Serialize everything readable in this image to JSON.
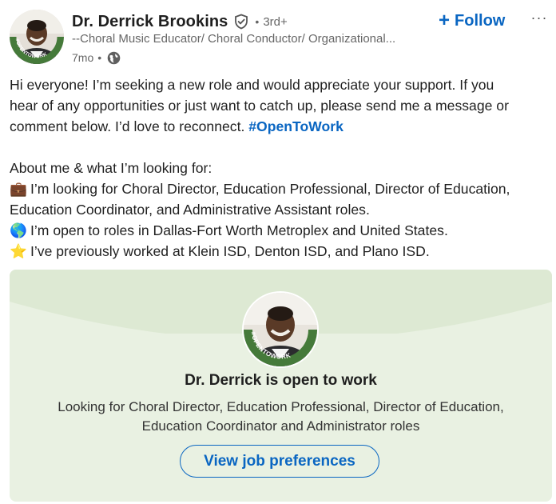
{
  "actor": {
    "name": "Dr. Derrick Brookins",
    "degree": "3rd+",
    "headline": "--Choral Music Educator/ Choral Conductor/ Organizational...",
    "time_ago": "7mo",
    "badge_text": "#OPENTOWORK"
  },
  "actions": {
    "follow_label": "Follow",
    "follow_plus": "+",
    "more_label": "···"
  },
  "commentary": {
    "line1": "Hi everyone! I’m seeking a new role and would appreciate your support. If you",
    "line2": "hear of any opportunities or just want to catch up, please send me a message or",
    "line3_text": "comment below. I’d love to reconnect. ",
    "hashtag": "#OpenToWork",
    "about": "About me & what I’m looking for:",
    "roles_line1": "I’m looking for Choral Director, Education Professional, Director of Education,",
    "roles_line2": "Education Coordinator, and Administrative Assistant roles.",
    "locations": "I’m open to roles in Dallas-Fort Worth Metroplex and United States.",
    "previous": "I’ve previously worked at Klein ISD, Denton ISD, and Plano ISD.",
    "emoji_briefcase": "💼",
    "emoji_globe": "🌎",
    "emoji_star": "⭐"
  },
  "otw_card": {
    "title": "Dr. Derrick is open to work",
    "description": "Looking for Choral Director, Education Professional, Director of Education, Education Coordinator and Administrator roles",
    "button_label": "View job preferences",
    "badge_text": "#OPENTOWORK"
  },
  "colors": {
    "accent": "#0a66c2",
    "otw_green": "#457a3a",
    "card_bg": "#e9f1e2"
  }
}
